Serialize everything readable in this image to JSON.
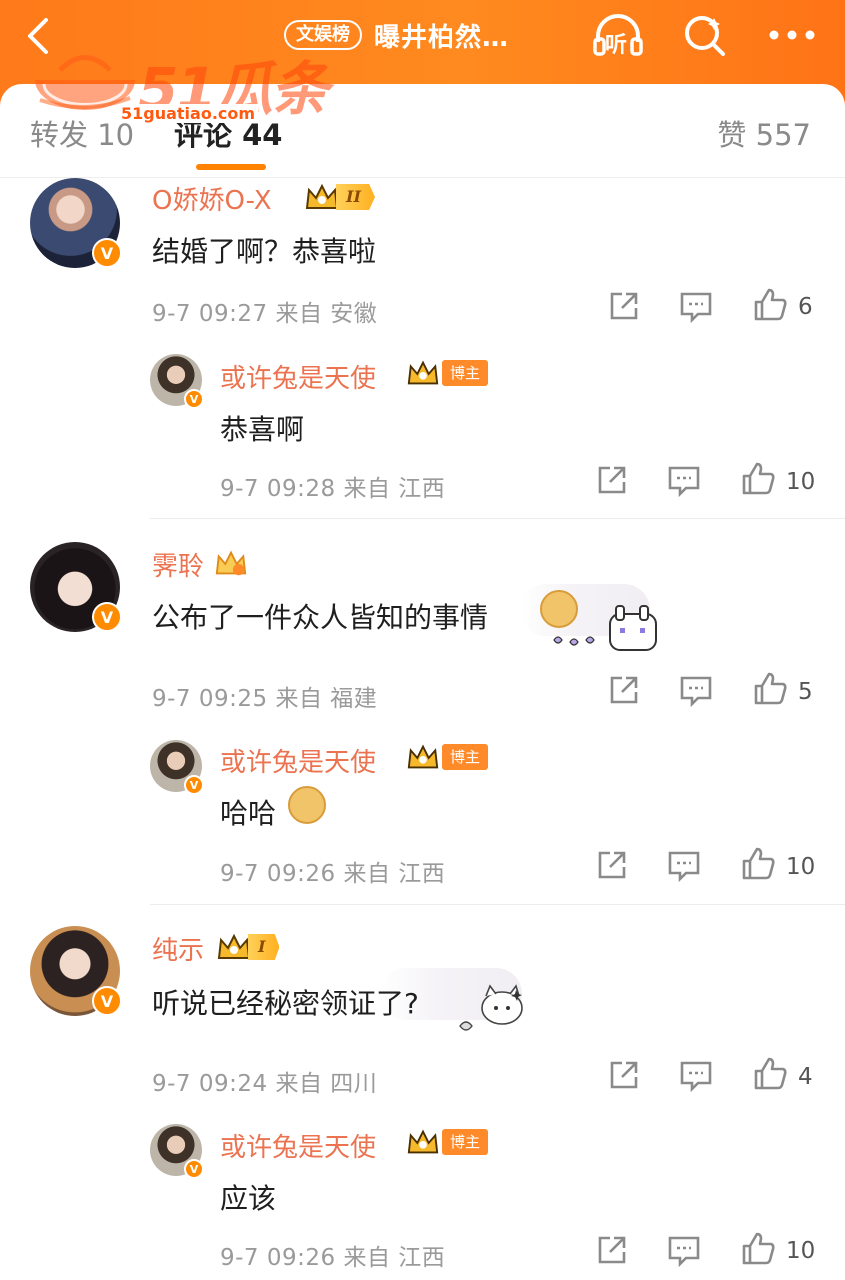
{
  "header": {
    "rank_tag": "文娱榜",
    "title": "曝井柏然…",
    "listen_label": "听",
    "accent_color": "#ff8200"
  },
  "watermark": {
    "logo_text": "51瓜条",
    "url": "51guatiao.com"
  },
  "tabs": {
    "repost": "转发 10",
    "comment": "评论 44",
    "like": "赞 557"
  },
  "comments": [
    {
      "name": "O娇娇O-X",
      "level": "II",
      "text": "结婚了啊？恭喜啦",
      "meta": "9-7 09:27 来自 安徽",
      "likes": "6",
      "reply": {
        "name": "或许兔是天使",
        "badge": "博主",
        "text": "恭喜啊",
        "meta": "9-7 09:28 来自 江西",
        "likes": "10"
      }
    },
    {
      "name": "霁聆",
      "text": "公布了一件众人皆知的事情",
      "meta": "9-7 09:25 来自 福建",
      "likes": "5",
      "reply": {
        "name": "或许兔是天使",
        "badge": "博主",
        "text": "哈哈",
        "meta": "9-7 09:26 来自 江西",
        "likes": "10"
      }
    },
    {
      "name": "纯示",
      "level": "I",
      "text": "听说已经秘密领证了?",
      "meta": "9-7 09:24 来自 四川",
      "likes": "4",
      "reply": {
        "name": "或许兔是天使",
        "badge": "博主",
        "text": "应该",
        "meta": "9-7 09:26 来自 江西",
        "likes": "10"
      }
    }
  ],
  "icons": {
    "repost": "share-square-icon",
    "comment": "comment-bubble-icon",
    "like": "thumbs-up-icon"
  }
}
